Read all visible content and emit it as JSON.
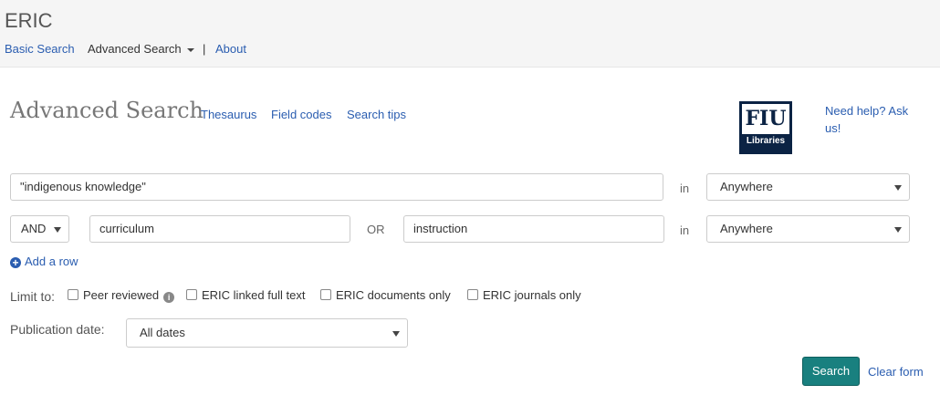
{
  "header": {
    "brand": "ERIC",
    "nav": {
      "basic_search": "Basic Search",
      "advanced_search": "Advanced Search",
      "separator": "|",
      "about": "About"
    }
  },
  "page": {
    "title": "Advanced Search",
    "links": {
      "thesaurus": "Thesaurus",
      "field_codes": "Field codes",
      "search_tips": "Search tips"
    },
    "logo": {
      "top": "FIU",
      "bottom": "Libraries"
    },
    "help_text": "Need help? Ask us!"
  },
  "search": {
    "row1": {
      "value": "\"indigenous knowledge\"",
      "in_label": "in",
      "field": "Anywhere"
    },
    "row2": {
      "operator": "AND",
      "value1": "curriculum",
      "or_label": "OR",
      "value2": "instruction",
      "in_label": "in",
      "field": "Anywhere"
    },
    "add_row": "Add a row",
    "limit_to": {
      "label": "Limit to:",
      "options": [
        "Peer reviewed",
        "ERIC linked full text",
        "ERIC documents only",
        "ERIC journals only"
      ]
    },
    "publication_date": {
      "label": "Publication date:",
      "value": "All dates"
    },
    "search_button": "Search",
    "clear_form": "Clear form"
  },
  "colors": {
    "link": "#2a5db0",
    "button": "#19807f",
    "logo_bg": "#0b2344",
    "header_bg": "#f5f5f5"
  }
}
